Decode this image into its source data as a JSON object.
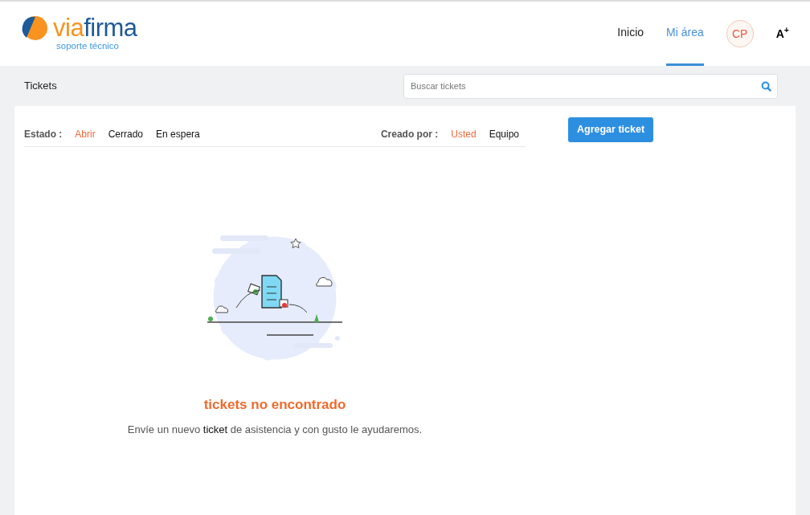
{
  "header": {
    "logo": {
      "words": [
        {
          "text": "via",
          "color": "#f7931e"
        },
        {
          "text": "firma",
          "color": "#1d5a98"
        }
      ],
      "tagline": "soporte técnico"
    },
    "nav": [
      {
        "label": "Inicio",
        "selected": false
      },
      {
        "label": "Mi área",
        "selected": true
      }
    ],
    "avatar": "CP",
    "font_size_button": "A$^{+}$"
  },
  "toolbar": {
    "title": "Tickets",
    "search": {
      "placeholder": "Buscar tickets"
    }
  },
  "filters": {
    "status": {
      "label": "Estado :",
      "options": [
        {
          "label": "Abrir",
          "selected": true
        },
        {
          "label": "Cerrado",
          "selected": false
        },
        {
          "label": "En espera",
          "selected": false
        }
      ]
    },
    "creator": {
      "label": "Creado por :",
      "options": [
        {
          "label": "Usted",
          "selected": true
        },
        {
          "label": "Equipo",
          "selected": false
        }
      ]
    }
  },
  "add_button": "Agregar ticket",
  "empty_state": {
    "title": "tickets no encontrado",
    "message": {
      "before": "Envíe un nuevo ",
      "link": "ticket",
      "after": " de asistencia y con gusto le ayudaremos."
    }
  }
}
